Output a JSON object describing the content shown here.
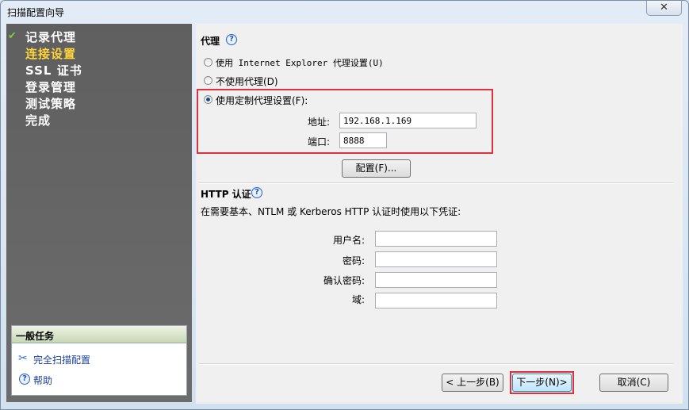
{
  "window": {
    "title": "扫描配置向导",
    "close_label": "✕"
  },
  "steps": [
    {
      "label": "记录代理",
      "status": "done"
    },
    {
      "label": "连接设置",
      "status": "current"
    },
    {
      "label": "SSL 证书",
      "status": "pending"
    },
    {
      "label": "登录管理",
      "status": "pending"
    },
    {
      "label": "测试策略",
      "status": "pending"
    },
    {
      "label": "完成",
      "status": "pending"
    }
  ],
  "tasks": {
    "header": "一般任务",
    "items": [
      {
        "label": "完全扫描配置",
        "icon": "tools-icon"
      },
      {
        "label": "帮助",
        "icon": "help-icon"
      }
    ]
  },
  "proxy": {
    "title": "代理",
    "help": "?",
    "options": [
      {
        "label": "使用 Internet Explorer 代理设置(U)",
        "selected": false
      },
      {
        "label": "不使用代理(D)",
        "selected": false
      },
      {
        "label": "使用定制代理设置(F):",
        "selected": true
      }
    ],
    "address_label": "地址:",
    "address_value": "192.168.1.169",
    "port_label": "端口:",
    "port_value": "8888",
    "config_button": "配置(F)..."
  },
  "http_auth": {
    "title": "HTTP 认证",
    "help": "?",
    "description": "在需要基本、NTLM 或 Kerberos HTTP 认证时使用以下凭证:",
    "fields": [
      {
        "label": "用户名:",
        "value": ""
      },
      {
        "label": "密码:",
        "value": ""
      },
      {
        "label": "确认密码:",
        "value": ""
      },
      {
        "label": "域:",
        "value": ""
      }
    ]
  },
  "buttons": {
    "back": "< 上一步(B)",
    "next": "下一步(N)>",
    "cancel": "取消(C)"
  },
  "colors": {
    "highlight_border": "#e0303c",
    "current_step": "#ffd43a",
    "left_panel": "#666666"
  }
}
